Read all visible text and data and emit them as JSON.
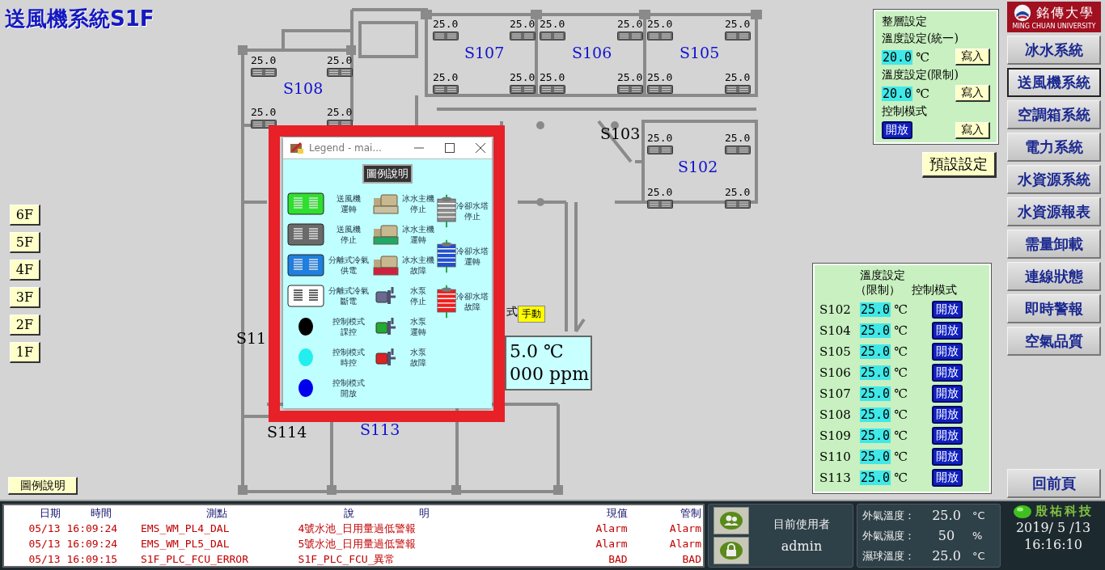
{
  "title": "送風機系統S1F",
  "floors": [
    "6F",
    "5F",
    "4F",
    "3F",
    "2F",
    "1F"
  ],
  "legend_button": "圖例說明",
  "rooms": [
    {
      "name": "S108",
      "color": "#1010d0",
      "sensors": [
        "25.0",
        "25.0",
        "25.0",
        "25.0"
      ]
    },
    {
      "name": "S107",
      "color": "#1010d0",
      "sensors": [
        "25.0",
        "25.0",
        "25.0",
        "25.0"
      ]
    },
    {
      "name": "S106",
      "color": "#1010d0",
      "sensors": [
        "25.0",
        "25.0",
        "25.0",
        "25.0"
      ]
    },
    {
      "name": "S105",
      "color": "#1010d0",
      "sensors": [
        "25.0",
        "25.0",
        "25.0",
        "25.0"
      ]
    },
    {
      "name": "S103",
      "color": "#000000"
    },
    {
      "name": "S102",
      "color": "#1010d0",
      "sensors": [
        "25.0",
        "25.0",
        "25.0",
        "25.0"
      ]
    },
    {
      "name": "S11",
      "color": "#000000"
    },
    {
      "name": "S114",
      "color": "#000000"
    },
    {
      "name": "S113",
      "color": "#1010d0"
    }
  ],
  "mode_label": "式",
  "mode_badge": "手動",
  "reading": {
    "temperature": "5.0 ℃",
    "co2": "000 ppm"
  },
  "legend": {
    "title": "Legend - mai...",
    "heading": "圖例說明",
    "columns": [
      [
        {
          "kind": "fan",
          "color": "#2ee02e",
          "lines": [
            "送風機",
            "運轉"
          ]
        },
        {
          "kind": "fan",
          "color": "#6a6a6a",
          "lines": [
            "送風機",
            "停止"
          ]
        },
        {
          "kind": "fan",
          "color": "#1e7fe0",
          "lines": [
            "分離式冷氣",
            "供電"
          ]
        },
        {
          "kind": "fan",
          "color": "#ffffff",
          "lines": [
            "分離式冷氣",
            "斷電"
          ]
        },
        {
          "kind": "mode",
          "color": "#000000",
          "lines": [
            "控制模式",
            "課控"
          ]
        },
        {
          "kind": "mode",
          "color": "#22eeee",
          "lines": [
            "控制模式",
            "時控"
          ]
        },
        {
          "kind": "mode",
          "color": "#0000ee",
          "lines": [
            "控制模式",
            "開放"
          ]
        }
      ],
      [
        {
          "kind": "chiller",
          "color": "#c8c0a0",
          "lines": [
            "冰水主機",
            "停止"
          ]
        },
        {
          "kind": "chiller",
          "color": "#1fa866",
          "lines": [
            "冰水主機",
            "運轉"
          ]
        },
        {
          "kind": "chiller",
          "color": "#d02040",
          "lines": [
            "冰水主機",
            "故障"
          ]
        },
        {
          "kind": "pump",
          "color": "#6a6a90",
          "lines": [
            "水泵",
            "停止"
          ]
        },
        {
          "kind": "pump",
          "color": "#22aa33",
          "lines": [
            "水泵",
            "運轉"
          ]
        },
        {
          "kind": "pump",
          "color": "#dd2222",
          "lines": [
            "水泵",
            "故障"
          ]
        }
      ],
      [
        {
          "kind": "tower",
          "color": "#8a8a8a",
          "lines": [
            "冷卻水塔",
            "停止"
          ]
        },
        {
          "kind": "tower",
          "color": "#2050d0",
          "lines": [
            "冷卻水塔",
            "運轉"
          ]
        },
        {
          "kind": "tower",
          "color": "#ee2020",
          "lines": [
            "冷卻水塔",
            "故障"
          ]
        }
      ]
    ]
  },
  "settings": {
    "title": "整層設定",
    "rows": [
      {
        "kind": "temperature",
        "label": "溫度設定(統一)",
        "value": "20.0",
        "unit": "℃",
        "button": "寫入"
      },
      {
        "kind": "temperature",
        "label": "溫度設定(限制)",
        "value": "20.0",
        "unit": "℃",
        "button": "寫入"
      },
      {
        "kind": "mode",
        "label": "控制模式",
        "mode": "開放",
        "button": "寫入"
      }
    ]
  },
  "default_button": "預設設定",
  "logo": {
    "name": "銘傳大學",
    "subtitle": "MING CHUAN UNIVERSITY"
  },
  "nav": [
    {
      "label": "冰水系統",
      "selected": false
    },
    {
      "label": "送風機系統",
      "selected": true
    },
    {
      "label": "空調箱系統",
      "selected": false
    },
    {
      "label": "電力系統",
      "selected": false
    },
    {
      "label": "水資源系統",
      "selected": false
    },
    {
      "label": "水資源報表",
      "selected": false
    },
    {
      "label": "需量卸載",
      "selected": false
    },
    {
      "label": "連線狀態",
      "selected": false
    },
    {
      "label": "即時警報",
      "selected": false
    },
    {
      "label": "空氣品質",
      "selected": false
    }
  ],
  "back_button": "回前頁",
  "room_settings": {
    "title": "溫度設定",
    "subtitle": "（限制）",
    "mode_header": "控制模式",
    "rows": [
      {
        "room": "S102",
        "value": "25.0",
        "unit": "℃",
        "mode": "開放"
      },
      {
        "room": "S104",
        "value": "25.0",
        "unit": "℃",
        "mode": "開放"
      },
      {
        "room": "S105",
        "value": "25.0",
        "unit": "℃",
        "mode": "開放"
      },
      {
        "room": "S106",
        "value": "25.0",
        "unit": "℃",
        "mode": "開放"
      },
      {
        "room": "S107",
        "value": "25.0",
        "unit": "℃",
        "mode": "開放"
      },
      {
        "room": "S108",
        "value": "25.0",
        "unit": "℃",
        "mode": "開放"
      },
      {
        "room": "S109",
        "value": "25.0",
        "unit": "℃",
        "mode": "開放"
      },
      {
        "room": "S110",
        "value": "25.0",
        "unit": "℃",
        "mode": "開放"
      },
      {
        "room": "S113",
        "value": "25.0",
        "unit": "℃",
        "mode": "開放"
      }
    ]
  },
  "alarms": {
    "columns": [
      "日期",
      "時間",
      "測點",
      "說明",
      "現值",
      "管制"
    ],
    "rows": [
      [
        "05/13",
        "16:09:24",
        "EMS_WM_PL4_DAL",
        "4號水池_日用量過低警報",
        "Alarm",
        "Alarm"
      ],
      [
        "05/13",
        "16:09:24",
        "EMS_WM_PL5_DAL",
        "5號水池_日用量過低警報",
        "Alarm",
        "Alarm"
      ],
      [
        "05/13",
        "16:09:15",
        "S1F_PLC_FCU_ERROR",
        "S1F_PLC_FCU_異常",
        "BAD",
        "BAD"
      ]
    ]
  },
  "user": {
    "label": "目前使用者",
    "name": "admin"
  },
  "weather": [
    {
      "label": "外氣溫度：",
      "value": "25.0",
      "unit": "°C"
    },
    {
      "label": "外氣濕度：",
      "value": "50",
      "unit": "%"
    },
    {
      "label": "濕球溫度：",
      "value": "25.0",
      "unit": "°C"
    }
  ],
  "vendor": {
    "name": "殷祐科技",
    "date": "2019/ 5 /13",
    "time": "16:16:10"
  }
}
